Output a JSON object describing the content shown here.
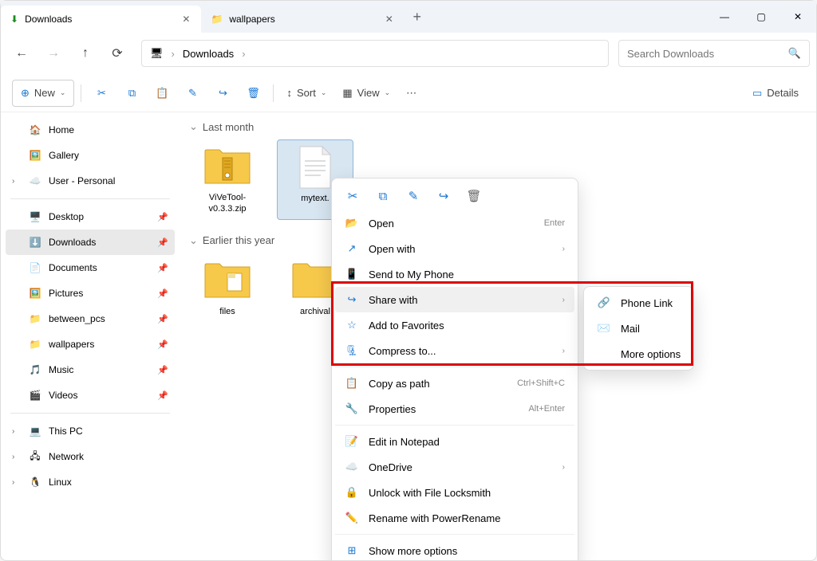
{
  "tabs": [
    {
      "label": "Downloads",
      "icon": "download"
    },
    {
      "label": "wallpapers",
      "icon": "folder"
    }
  ],
  "breadcrumb": {
    "current": "Downloads"
  },
  "search": {
    "placeholder": "Search Downloads"
  },
  "toolbar": {
    "new_label": "New",
    "sort_label": "Sort",
    "view_label": "View",
    "details_label": "Details"
  },
  "sidebar": {
    "top": [
      {
        "label": "Home",
        "icon": "🏠"
      },
      {
        "label": "Gallery",
        "icon": "🖼️"
      },
      {
        "label": "User - Personal",
        "icon": "☁️",
        "expandable": true
      }
    ],
    "quick": [
      {
        "label": "Desktop",
        "icon": "🖥️"
      },
      {
        "label": "Downloads",
        "icon": "⬇️",
        "selected": true
      },
      {
        "label": "Documents",
        "icon": "📄"
      },
      {
        "label": "Pictures",
        "icon": "🖼️"
      },
      {
        "label": "between_pcs",
        "icon": "📁"
      },
      {
        "label": "wallpapers",
        "icon": "📁"
      },
      {
        "label": "Music",
        "icon": "🎵"
      },
      {
        "label": "Videos",
        "icon": "🎬"
      }
    ],
    "bottom": [
      {
        "label": "This PC",
        "icon": "💻"
      },
      {
        "label": "Network",
        "icon": "🖧"
      },
      {
        "label": "Linux",
        "icon": "🐧"
      }
    ]
  },
  "groups": [
    {
      "label": "Last month",
      "items": [
        {
          "label": "ViVeTool-v0.3.3.zip",
          "type": "zip"
        },
        {
          "label": "mytext.",
          "type": "txt",
          "selected": true
        }
      ]
    },
    {
      "label": "Earlier this year",
      "items": [
        {
          "label": "files",
          "type": "folder"
        },
        {
          "label": "archival",
          "type": "folder"
        }
      ]
    }
  ],
  "context_menu": {
    "items": [
      {
        "label": "Open",
        "icon": "📂",
        "hint": "Enter"
      },
      {
        "label": "Open with",
        "icon": "↗",
        "arrow": true
      },
      {
        "label": "Send to My Phone",
        "icon": "📱"
      },
      {
        "label": "Share with",
        "icon": "↪",
        "arrow": true,
        "hover": true
      },
      {
        "label": "Add to Favorites",
        "icon": "☆"
      },
      {
        "label": "Compress to...",
        "icon": "🗜",
        "arrow": true
      }
    ],
    "items2": [
      {
        "label": "Copy as path",
        "icon": "📋",
        "hint": "Ctrl+Shift+C"
      },
      {
        "label": "Properties",
        "icon": "🔧",
        "hint": "Alt+Enter"
      }
    ],
    "items3": [
      {
        "label": "Edit in Notepad",
        "icon": "📝"
      },
      {
        "label": "OneDrive",
        "icon": "☁️",
        "arrow": true
      },
      {
        "label": "Unlock with File Locksmith",
        "icon": "🔒"
      },
      {
        "label": "Rename with PowerRename",
        "icon": "✏️"
      }
    ],
    "show_more": "Show more options"
  },
  "submenu": {
    "items": [
      {
        "label": "Phone Link",
        "icon": "🔗"
      },
      {
        "label": "Mail",
        "icon": "✉️"
      },
      {
        "label": "More options",
        "icon": ""
      }
    ]
  }
}
